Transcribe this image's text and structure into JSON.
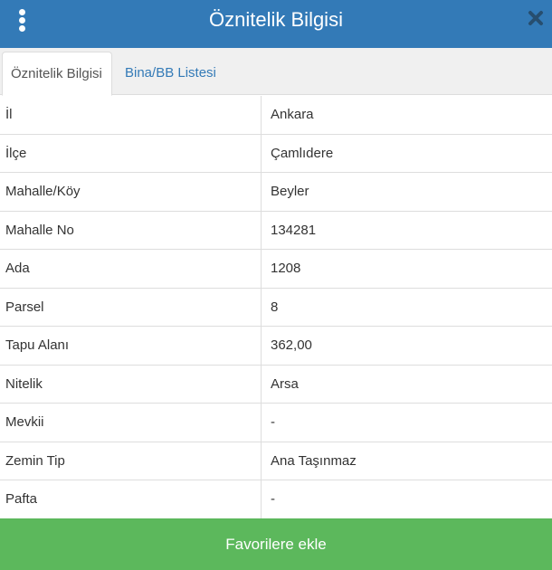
{
  "header": {
    "title": "Öznitelik Bilgisi",
    "menu_icon": "kebab-menu-icon",
    "close_icon": "close-icon"
  },
  "tabs": [
    {
      "label": "Öznitelik Bilgisi",
      "active": true
    },
    {
      "label": "Bina/BB Listesi",
      "active": false
    }
  ],
  "attributes": [
    {
      "label": "İl",
      "value": "Ankara"
    },
    {
      "label": "İlçe",
      "value": "Çamlıdere"
    },
    {
      "label": "Mahalle/Köy",
      "value": "Beyler"
    },
    {
      "label": "Mahalle No",
      "value": "134281"
    },
    {
      "label": "Ada",
      "value": "1208"
    },
    {
      "label": "Parsel",
      "value": "8"
    },
    {
      "label": "Tapu Alanı",
      "value": "362,00"
    },
    {
      "label": "Nitelik",
      "value": "Arsa"
    },
    {
      "label": "Mevkii",
      "value": "-"
    },
    {
      "label": "Zemin Tip",
      "value": "Ana Taşınmaz"
    },
    {
      "label": "Pafta",
      "value": "-"
    }
  ],
  "footer": {
    "favorite_label": "Favorilere ekle"
  },
  "colors": {
    "header_bg": "#337ab7",
    "tab_bar_bg": "#f0f0f0",
    "link": "#337ab7",
    "button_bg": "#5cb85c",
    "border": "#dddddd"
  }
}
